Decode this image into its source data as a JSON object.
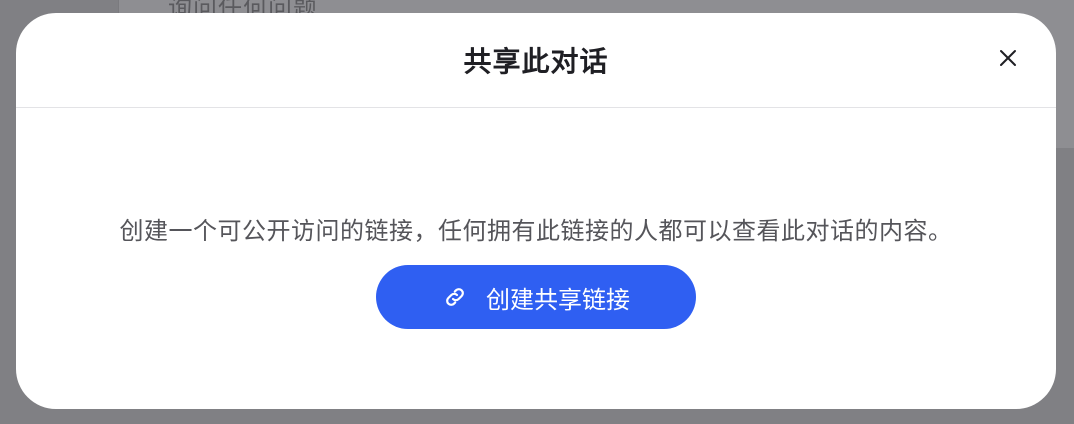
{
  "background": {
    "input_text": "询问任何问题..."
  },
  "dialog": {
    "title": "共享此对话",
    "description": "创建一个可公开访问的链接，任何拥有此链接的人都可以查看此对话的内容。",
    "create_button_label": "创建共享链接",
    "close_icon": "close-icon",
    "button_icon": "link-icon"
  },
  "colors": {
    "accent": "#2f5ff2",
    "overlay": "#808084",
    "title": "#1f1f24",
    "description": "#55555a"
  }
}
